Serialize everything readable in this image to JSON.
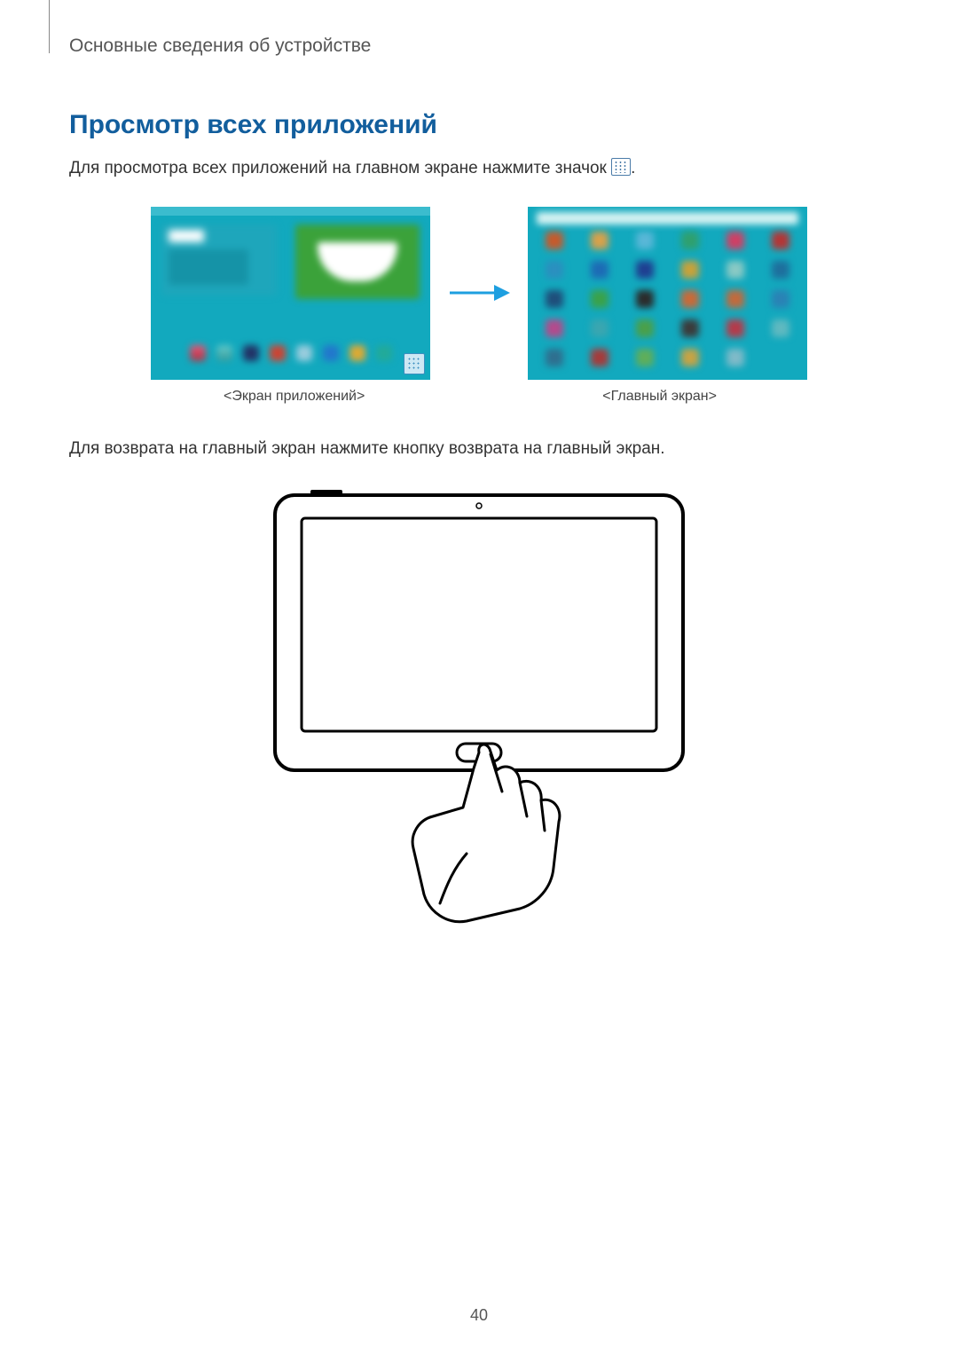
{
  "header": {
    "breadcrumb": "Основные сведения об устройстве"
  },
  "section": {
    "title": "Просмотр всех приложений",
    "intro_pre": "Для просмотра всех приложений на главном экране нажмите значок ",
    "intro_post": "."
  },
  "captions": {
    "left": "<Экран приложений>",
    "right": "<Главный экран>"
  },
  "body2": "Для возврата на главный экран нажмите кнопку возврата на главный экран.",
  "page_number": "40",
  "icons": {
    "apps": "apps-grid-icon",
    "arrow": "arrow-right-icon"
  },
  "colors": {
    "heading": "#125e9d",
    "arrow": "#1e9fe0",
    "screenshot_bg": "#12a9be"
  },
  "grid_icon_colors": [
    "#c65a2b",
    "#d8a14a",
    "#59b7d7",
    "#2fa06e",
    "#cf3f65",
    "#b43535",
    "#2b8fbf",
    "#1d6bb5",
    "#1f3f91",
    "#c7a23a",
    "#89c9c4",
    "#1e6f9d",
    "#1f4e7a",
    "#3aa24a",
    "#2b2b2b",
    "#c96a38",
    "#c26a3c",
    "#2a82b5",
    "#b44a8c",
    "#3aa6b0",
    "#4aa04a",
    "#3b3b3b",
    "#b53a4a",
    "#5fb9c0",
    "#2f6f8f",
    "#a63a3a",
    "#5fae5a",
    "#c7a344",
    "#7fbac8",
    ""
  ]
}
